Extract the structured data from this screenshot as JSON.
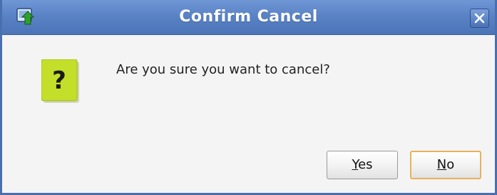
{
  "window": {
    "title": "Confirm Cancel",
    "icon": "app-icon",
    "close_icon": "close-icon"
  },
  "message": {
    "icon": "question-icon",
    "icon_glyph": "?",
    "text": "Are you sure you want to cancel?"
  },
  "buttons": {
    "yes": {
      "mnemonic": "Y",
      "rest": "es"
    },
    "no": {
      "mnemonic": "N",
      "rest": "o"
    }
  },
  "colors": {
    "titlebar": "#5a83c6",
    "border": "#4a6fae",
    "question_icon_bg": "#c4df2a",
    "default_button_border": "#e8b25a"
  }
}
